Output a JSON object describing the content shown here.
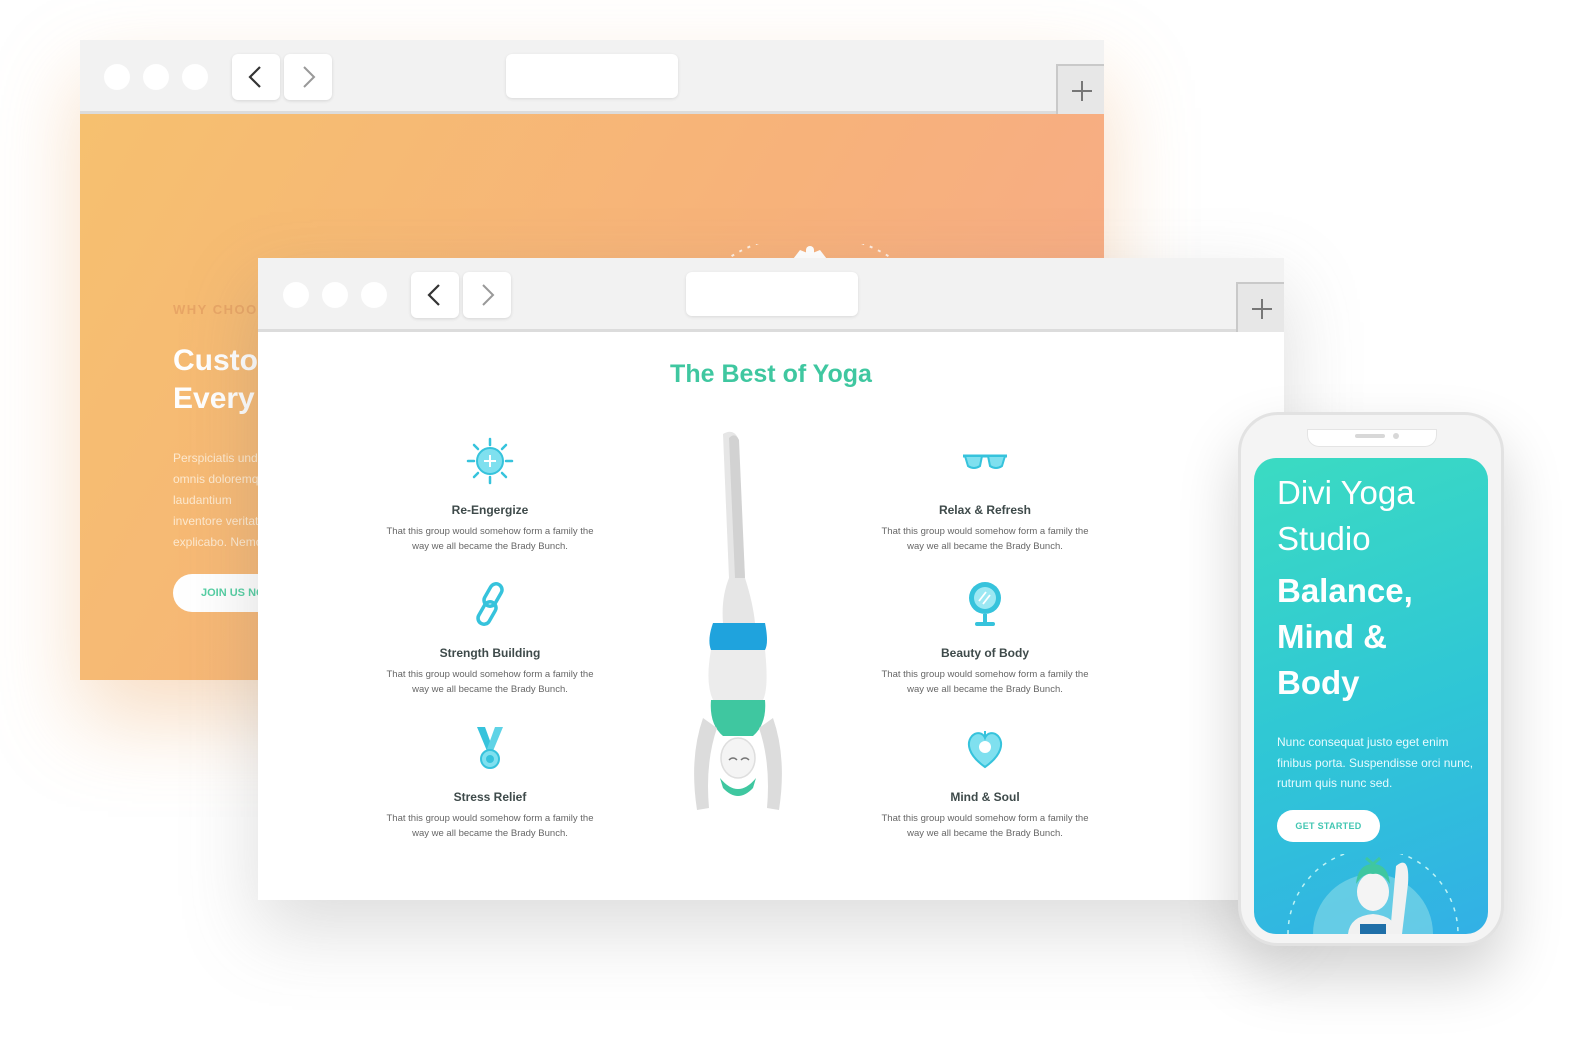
{
  "back_window": {
    "eyebrow": "WHY CHOOSE US",
    "title": "Custo\nEvery",
    "paragraph": "Perspiciatis unde omnis doloremque laudantium inventore veritatis explicabo. Nemo enim odit aut fugit, sed",
    "button_label": "JOIN US NOW"
  },
  "front_window": {
    "section_title": "The Best of Yoga",
    "features": [
      {
        "title": "Re-Engergize",
        "desc": "That this group would somehow form a family the way we all became the Brady Bunch.",
        "icon": "sun-icon"
      },
      {
        "title": "Strength Building",
        "desc": "That this group would somehow form a family the way we all became the Brady Bunch.",
        "icon": "chain-link-icon"
      },
      {
        "title": "Stress Relief",
        "desc": "That this group would somehow form a family the way we all became the Brady Bunch.",
        "icon": "medal-icon"
      },
      {
        "title": "Relax & Refresh",
        "desc": "That this group would somehow form a family the way we all became the Brady Bunch.",
        "icon": "sunglasses-icon"
      },
      {
        "title": "Beauty of Body",
        "desc": "That this group would somehow form a family the way we all became the Brady Bunch.",
        "icon": "mirror-icon"
      },
      {
        "title": "Mind & Soul",
        "desc": "That this group would somehow form a family the way we all became the Brady Bunch.",
        "icon": "heart-icon"
      }
    ]
  },
  "phone": {
    "heading": "Divi Yoga\nStudio",
    "headline": "Balance,\nMind &\nBody",
    "paragraph": "Nunc consequat justo eget enim finibus porta. Suspendisse orci nunc, rutrum quis nunc sed.",
    "button_label": "GET STARTED"
  },
  "colors": {
    "accent_green": "#3fc7a0",
    "icon_teal": "#36c3dc",
    "orange_gradient_start": "#f6c06f",
    "orange_gradient_end": "#f7a98a",
    "phone_gradient_start": "#3bdbc2",
    "phone_gradient_end": "#32b0e6"
  }
}
